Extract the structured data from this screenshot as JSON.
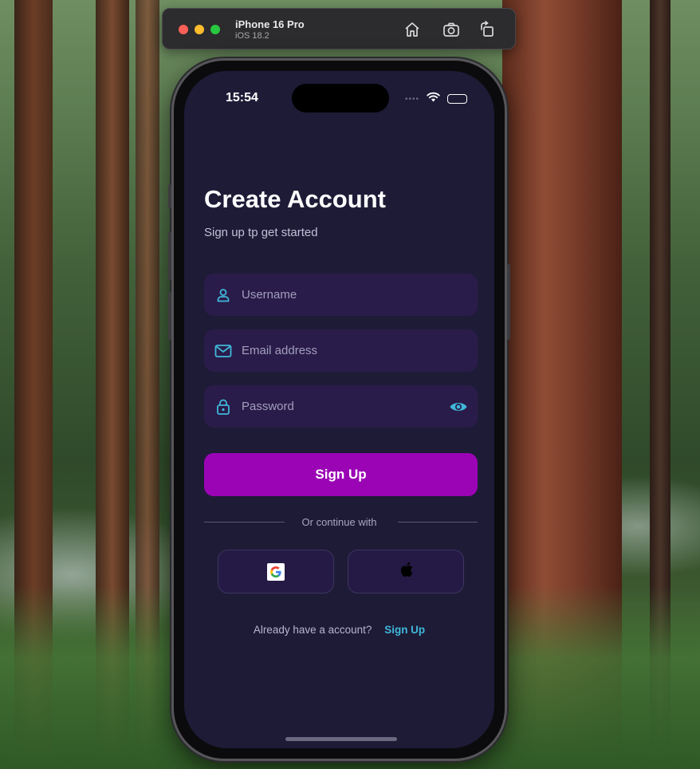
{
  "simulator": {
    "device_name": "iPhone 16 Pro",
    "os_version": "iOS 18.2",
    "buttons": [
      "home-icon",
      "screenshot-icon",
      "rotate-icon"
    ]
  },
  "status_bar": {
    "time": "15:54",
    "signal": "••••"
  },
  "screen": {
    "title": "Create Account",
    "subtitle": "Sign up tp get started",
    "fields": {
      "username_placeholder": "Username",
      "email_placeholder": "Email address",
      "password_placeholder": "Password"
    },
    "primary_button": "Sign Up",
    "divider_text": "Or continue with",
    "social": [
      "google-icon",
      "apple-icon"
    ],
    "footer_question": "Already have a account?",
    "footer_link": "Sign Up"
  },
  "colors": {
    "background": "#1e1b37",
    "field_bg": "#2a1c4a",
    "accent_purple": "#9b04b5",
    "accent_cyan": "#3fb8d9"
  }
}
